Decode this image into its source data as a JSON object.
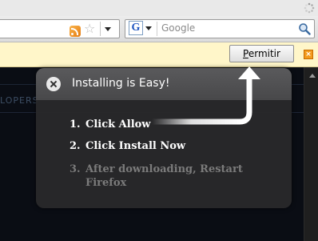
{
  "browser": {
    "search": {
      "engine_icon": "google-g-icon",
      "placeholder": "Google"
    }
  },
  "notification": {
    "button_label_underlined": "P",
    "button_label_rest": "ermitir"
  },
  "page": {
    "partial_text": "LOPERS"
  },
  "popup": {
    "title": "Installing is Easy!",
    "steps": [
      {
        "num": "1.",
        "text": "Click Allow"
      },
      {
        "num": "2.",
        "text": "Click Install Now"
      },
      {
        "num": "3.",
        "text_line1": "After downloading, Restart",
        "text_line2": "Firefox"
      }
    ]
  },
  "colors": {
    "notification_bg": "#fff6c9",
    "popup_bg": "#282828",
    "popup_header": "#4f4f51",
    "active_step": "#ffffff",
    "inactive_step": "#7b7b7b",
    "close_accent": "#f39b1d"
  }
}
